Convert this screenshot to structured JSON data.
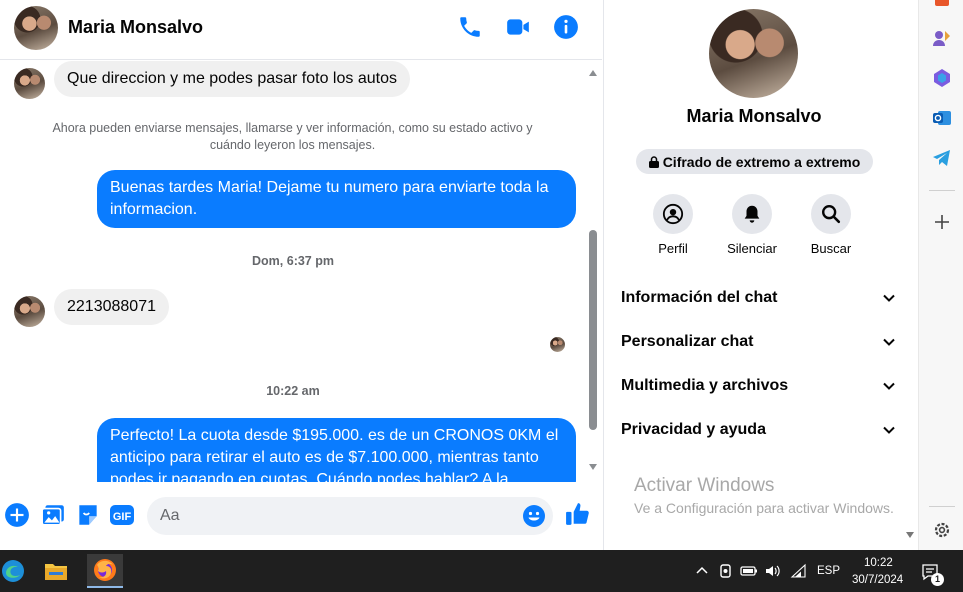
{
  "header": {
    "contact_name": "Maria Monsalvo",
    "icons": [
      "phone-icon",
      "video-camera-icon",
      "info-icon"
    ]
  },
  "messages": {
    "incoming_1": "Que direccion y me podes pasar foto los autos",
    "system_notice": "Ahora pueden enviarse mensajes, llamarse y ver información, como su estado activo y cuándo leyeron los mensajes.",
    "outgoing_1": "Buenas tardes Maria! Dejame tu numero para enviarte toda la informacion.",
    "time_1": "Dom, 6:37 pm",
    "incoming_2": "2213088071",
    "time_2": "10:22 am",
    "outgoing_2": "Perfecto! La cuota desde $195.000. es de un CRONOS 0KM el anticipo para retirar el auto es de $7.100.000, mientras tanto podes ir pagando en cuotas. Cuándo podes hablar? A la"
  },
  "composer": {
    "placeholder": "Aa",
    "icons": [
      "plus-circle-icon",
      "photo-icon",
      "sticker-icon",
      "gif-icon",
      "emoji-icon",
      "thumbs-up-icon"
    ],
    "gif_label": "GIF"
  },
  "info_panel": {
    "name": "Maria Monsalvo",
    "encryption_label": "Cifrado de extremo a extremo",
    "actions": [
      {
        "label": "Perfil",
        "icon": "profile-icon"
      },
      {
        "label": "Silenciar",
        "icon": "bell-icon"
      },
      {
        "label": "Buscar",
        "icon": "search-icon"
      }
    ],
    "sections": [
      {
        "label": "Información del chat"
      },
      {
        "label": "Personalizar chat"
      },
      {
        "label": "Multimedia y archivos"
      },
      {
        "label": "Privacidad y ayuda"
      }
    ],
    "watermark_title": "Activar Windows",
    "watermark_sub": "Ve a Configuración para activar Windows."
  },
  "taskbar": {
    "language": "ESP",
    "time": "10:22",
    "date": "30/7/2024",
    "notification_count": "1"
  },
  "colors": {
    "accent": "#0a7cff",
    "bubble_in": "#f0f0f0",
    "taskbar": "#1f1f1f"
  }
}
